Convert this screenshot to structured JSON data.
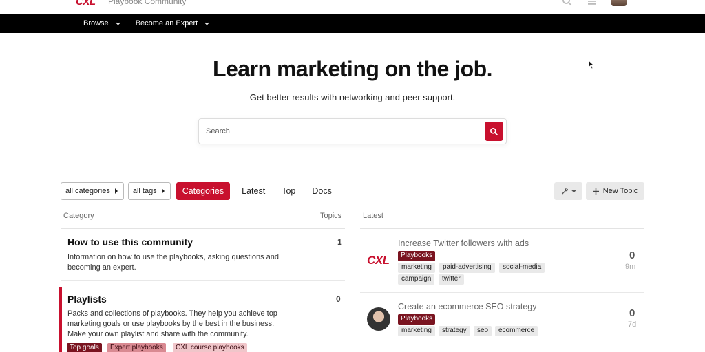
{
  "header": {
    "logo_text": "CXL",
    "site_name": "Playbook Community",
    "icons": [
      "search-icon",
      "hamburger-menu-icon",
      "user-avatar"
    ]
  },
  "nav": {
    "items": [
      {
        "label": "Browse"
      },
      {
        "label": "Become an Expert"
      }
    ]
  },
  "hero": {
    "title": "Learn marketing on the job.",
    "subtitle": "Get better results with networking and peer support.",
    "search_placeholder": "Search"
  },
  "filters": {
    "categories_dropdown": "all categories",
    "tags_dropdown": "all tags",
    "tabs": [
      "Categories",
      "Latest",
      "Top",
      "Docs"
    ],
    "active_tab": "Categories",
    "new_topic_label": "New Topic"
  },
  "categories_table": {
    "col_category": "Category",
    "col_topics": "Topics",
    "rows": [
      {
        "title": "How to use this community",
        "topics": "1",
        "description": "Information on how to use the playbooks, asking questions and becoming an expert."
      },
      {
        "title": "Playlists",
        "topics": "0",
        "description": "Packs and collections of playbooks. They help you achieve top marketing goals or use playbooks by the best in the business. Make your own playlist and share with the community.",
        "subcategories": [
          "Top goals",
          "Expert playbooks",
          "CXL course playbooks"
        ]
      }
    ]
  },
  "latest": {
    "heading": "Latest",
    "topics": [
      {
        "avatar_text": "CXL",
        "title": "Increase Twitter followers with ads",
        "category": "Playbooks",
        "tags": [
          "marketing",
          "paid-advertising",
          "social-media",
          "campaign",
          "twitter"
        ],
        "count": "0",
        "age": "9m"
      },
      {
        "title": "Create an ecommerce SEO strategy",
        "category": "Playbooks",
        "tags": [
          "marketing",
          "strategy",
          "seo",
          "ecommerce"
        ],
        "count": "0",
        "age": "7d"
      }
    ]
  },
  "colors": {
    "brand_red": "#c8102e",
    "badge_dark_red": "#7a1420",
    "nav_bg": "#000000"
  }
}
